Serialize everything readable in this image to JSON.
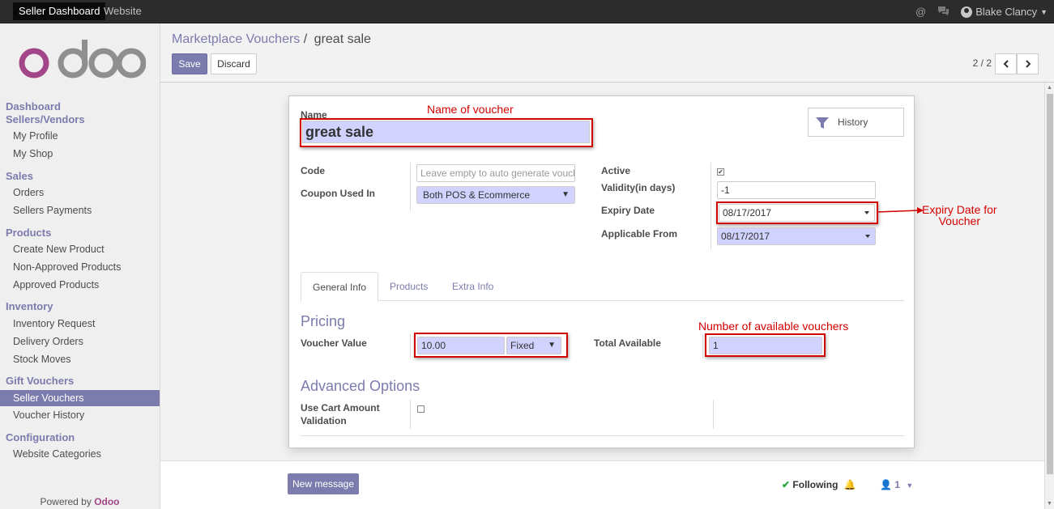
{
  "topbar": {
    "menus": [
      {
        "label": "Seller Dashboard",
        "active": true
      },
      {
        "label": "Website",
        "active": false
      }
    ],
    "user_name": "Blake Clancy"
  },
  "sidebar": {
    "sections": [
      {
        "title": "Dashboard",
        "items": []
      },
      {
        "title": "Sellers/Vendors",
        "items": [
          "My Profile",
          "My Shop"
        ]
      },
      {
        "title": "Sales",
        "items": [
          "Orders",
          "Sellers Payments"
        ]
      },
      {
        "title": "Products",
        "items": [
          "Create New Product",
          "Non-Approved Products",
          "Approved Products"
        ]
      },
      {
        "title": "Inventory",
        "items": [
          "Inventory Request",
          "Delivery Orders",
          "Stock Moves"
        ]
      },
      {
        "title": "Gift Vouchers",
        "items": [
          "Seller Vouchers",
          "Voucher History"
        ]
      },
      {
        "title": "Configuration",
        "items": [
          "Website Categories"
        ]
      }
    ],
    "active_item": "Seller Vouchers",
    "powered_by_prefix": "Powered by",
    "powered_by_brand": "Odoo"
  },
  "control": {
    "breadcrumb_parent": "Marketplace Vouchers",
    "breadcrumb_sep": "/",
    "breadcrumb_current": "great sale",
    "save_label": "Save",
    "discard_label": "Discard",
    "pager": "2 / 2"
  },
  "form": {
    "name_label": "Name",
    "name_value": "great sale",
    "history_label": "History",
    "code_label": "Code",
    "code_placeholder": "Leave empty to auto generate vouch",
    "coupon_label": "Coupon Used In",
    "coupon_value": "Both POS & Ecommerce",
    "active_label": "Active",
    "active_checked": true,
    "validity_label": "Validity(in days)",
    "validity_value": "-1",
    "expiry_label": "Expiry Date",
    "expiry_value": "08/17/2017",
    "applicable_label": "Applicable From",
    "applicable_value": "08/17/2017",
    "tabs": [
      "General Info",
      "Products",
      "Extra Info"
    ],
    "active_tab": "General Info",
    "pricing_title": "Pricing",
    "voucher_value_label": "Voucher Value",
    "voucher_value": "10.00",
    "voucher_type": "Fixed",
    "total_available_label": "Total Available",
    "total_available_value": "1",
    "advanced_title": "Advanced Options",
    "cart_validation_label_1": "Use Cart Amount",
    "cart_validation_label_2": "Validation",
    "cart_validation_checked": false
  },
  "annotations": {
    "name": "Name of voucher",
    "expiry_line1": "Expiry Date for",
    "expiry_line2": "Voucher",
    "available": "Number of available vouchers"
  },
  "chatter": {
    "new_message": "New message",
    "following": "Following",
    "followers_count": "1"
  },
  "colors": {
    "brand": "#7c7bad",
    "annotation": "#d30000",
    "required_field": "#d2d2ff"
  }
}
